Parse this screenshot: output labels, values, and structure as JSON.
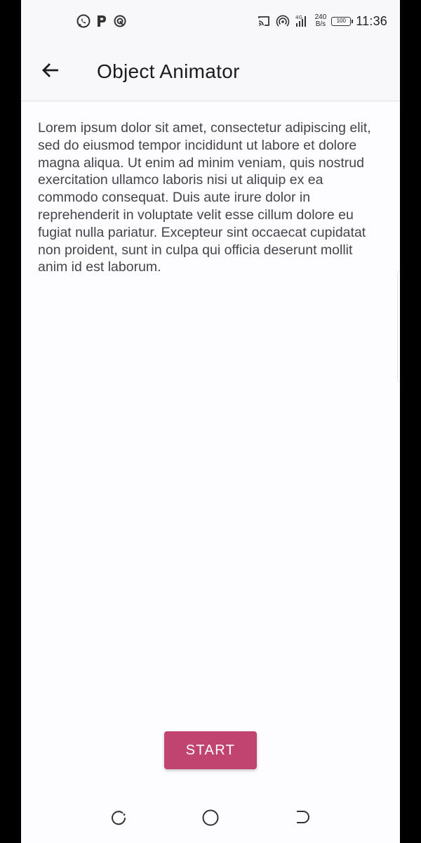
{
  "status_bar": {
    "left_icons": [
      "whatsapp-icon",
      "parking-icon",
      "signal-app-icon"
    ],
    "right_icons": [
      "cast-icon",
      "hotspot-icon",
      "cellular-4g-icon"
    ],
    "net_speed_value": "240",
    "net_speed_unit": "B/s",
    "battery_level": "100",
    "time": "11:36"
  },
  "app_bar": {
    "back_icon": "arrow-back-icon",
    "title": "Object Animator"
  },
  "content": {
    "paragraph": "Lorem ipsum dolor sit amet, consectetur adipiscing elit, sed do eiusmod tempor incididunt ut labore et dolore magna aliqua. Ut enim ad minim veniam, quis nostrud exercitation ullamco laboris nisi ut aliquip ex ea commodo consequat. Duis aute irure dolor in reprehenderit in voluptate velit esse cillum dolore eu fugiat nulla pariatur. Excepteur sint occaecat cupidatat non proident, sunt in culpa qui officia deserunt mollit anim id est laborum."
  },
  "actions": {
    "start_label": "START"
  },
  "nav_bar": {
    "icons": [
      "recents-icon",
      "home-icon",
      "back-nav-icon"
    ]
  },
  "colors": {
    "accent": "#c1436f",
    "surface": "#fdfcff",
    "app_bar": "#f8f8fa",
    "text_primary": "#1b1b1f",
    "text_body": "#44444a"
  }
}
